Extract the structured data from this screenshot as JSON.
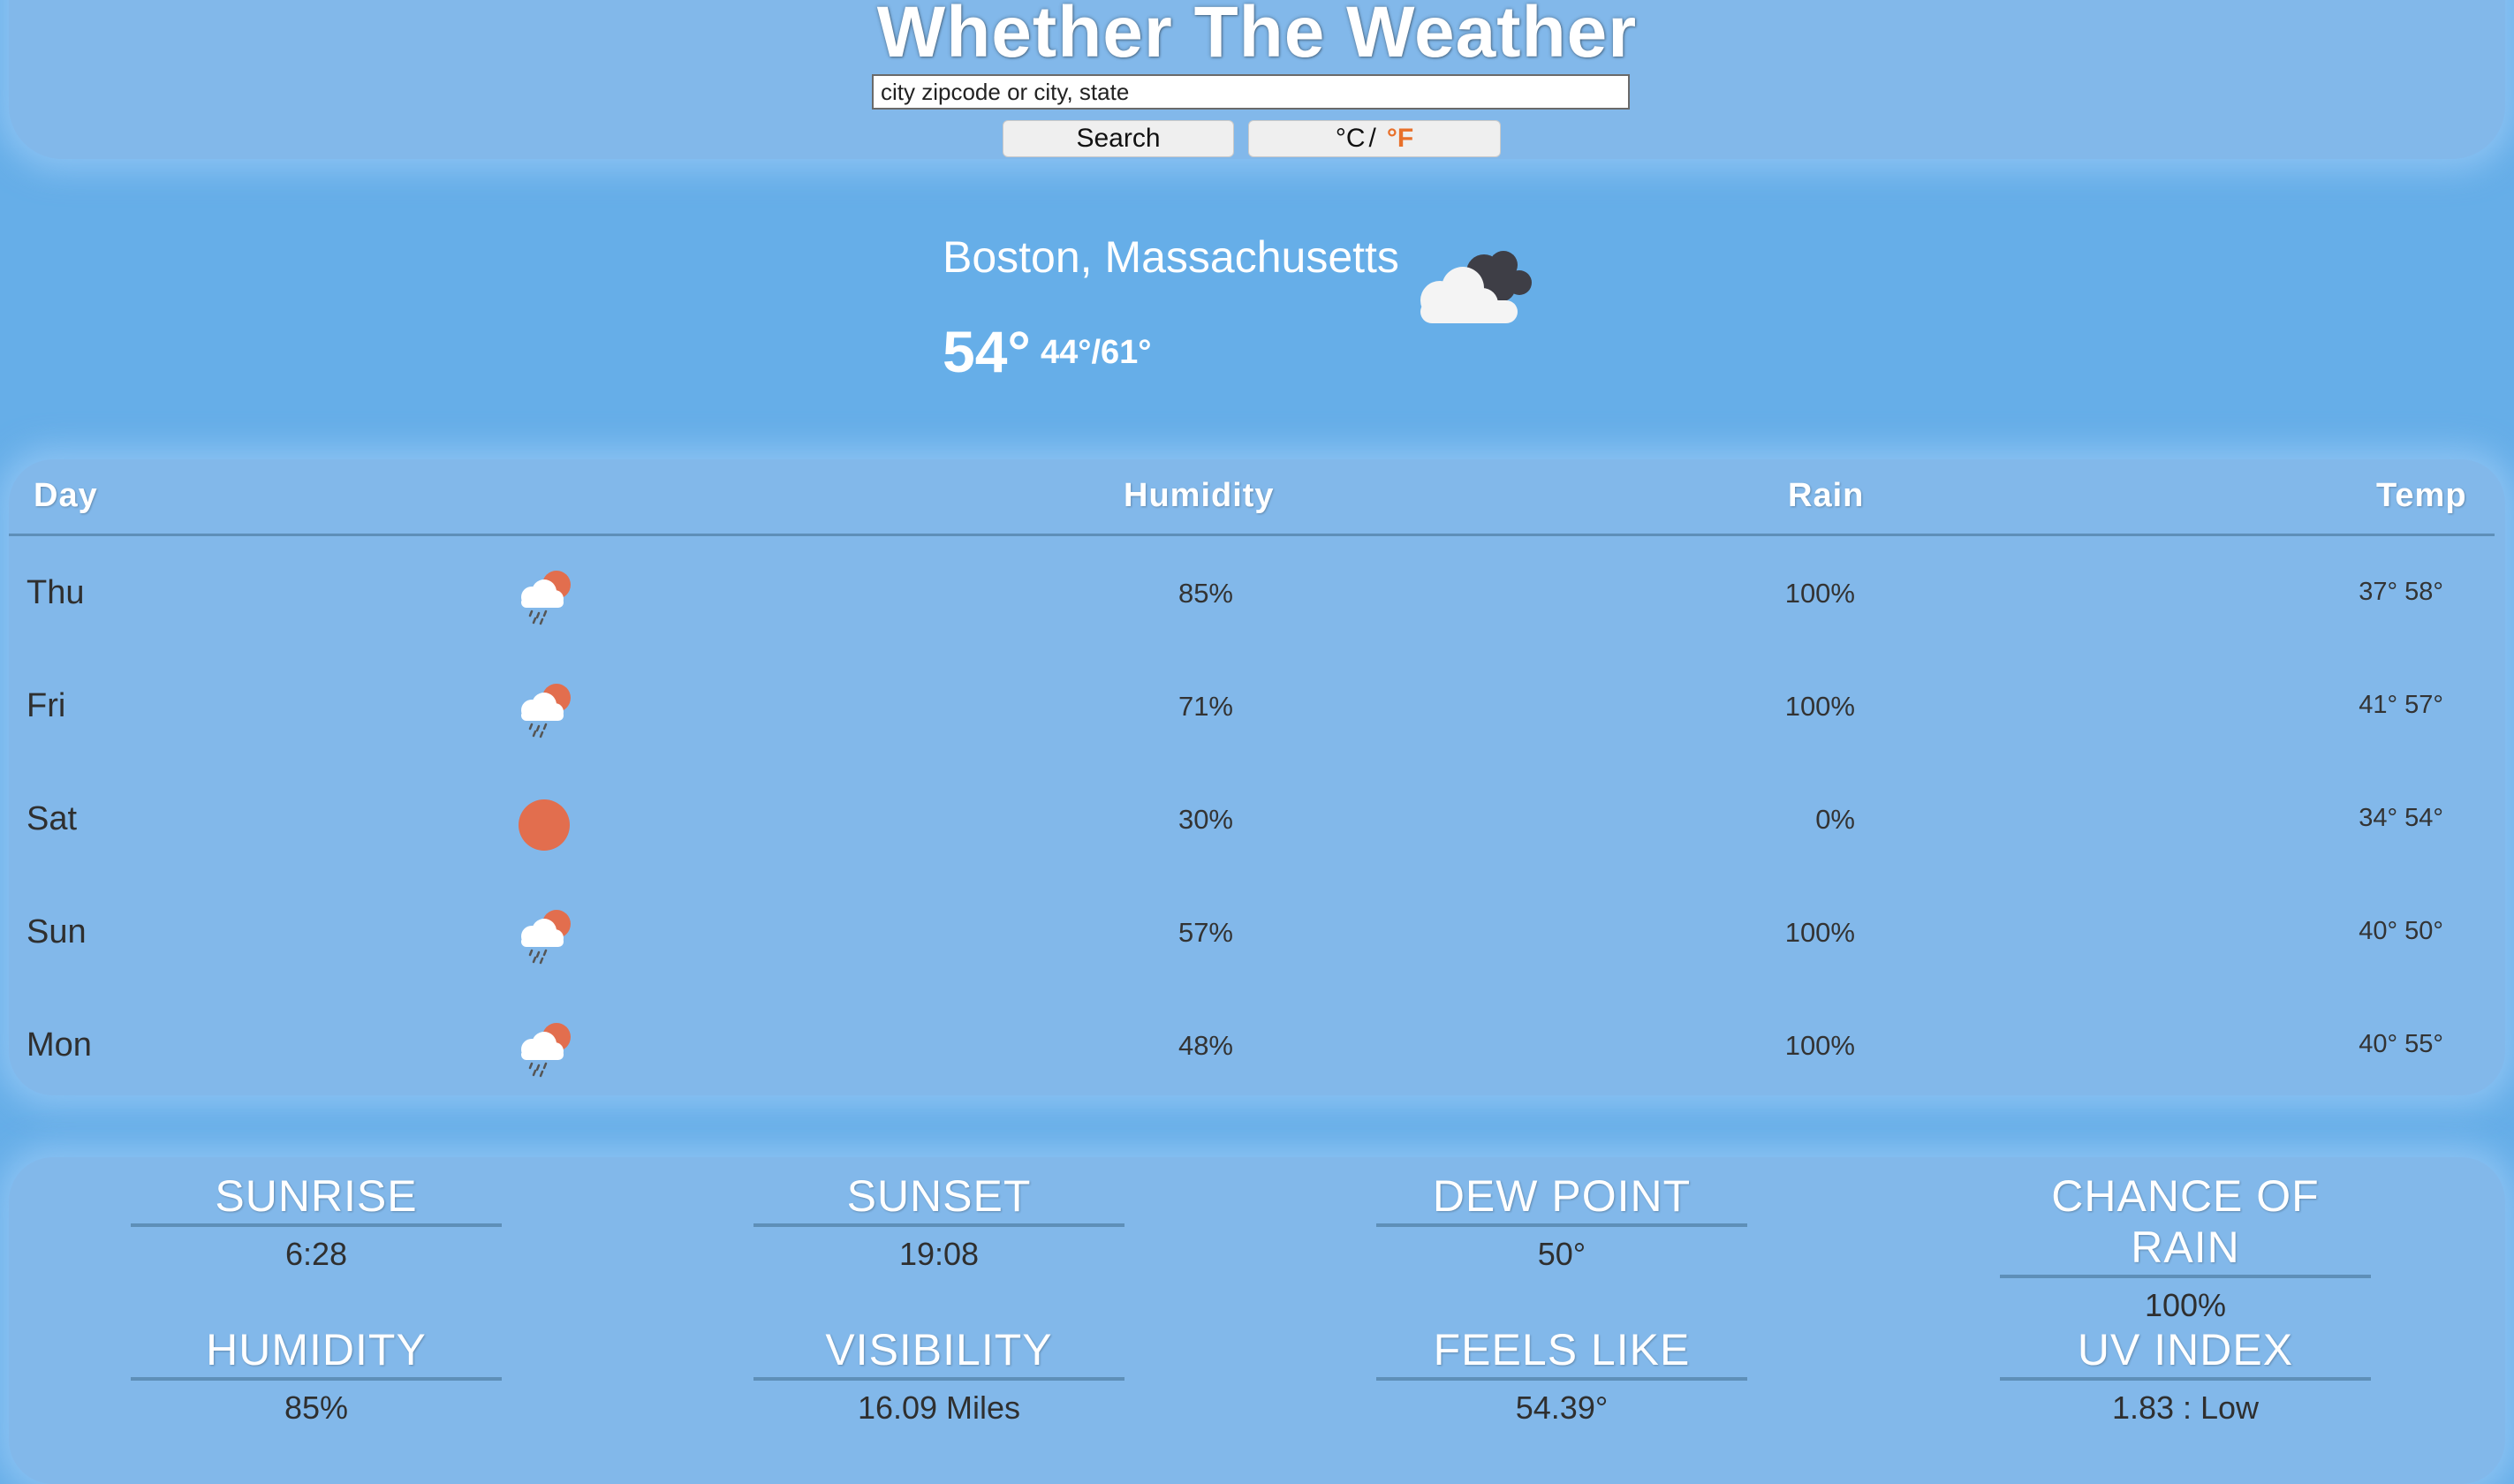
{
  "header": {
    "title": "Whether The Weather",
    "search_placeholder": "city zipcode or city, state",
    "search_label": "Search",
    "unit_c": "°C",
    "unit_sep": "/",
    "unit_f": "°F",
    "accent_color": "#e8702a"
  },
  "current": {
    "city": "Boston, Massachusetts",
    "temp": "54°",
    "range": "44°/61°",
    "icon": "cloud-icon"
  },
  "forecast": {
    "headers": {
      "day": "Day",
      "humidity": "Humidity",
      "rain": "Rain",
      "temp": "Temp"
    },
    "rows": [
      {
        "day": "Thu",
        "icon": "rain-partly-sunny-icon",
        "humidity": "85%",
        "rain": "100%",
        "temp": "37° 58°"
      },
      {
        "day": "Fri",
        "icon": "rain-partly-sunny-icon",
        "humidity": "71%",
        "rain": "100%",
        "temp": "41° 57°"
      },
      {
        "day": "Sat",
        "icon": "sun-icon",
        "humidity": "30%",
        "rain": "0%",
        "temp": "34° 54°"
      },
      {
        "day": "Sun",
        "icon": "rain-partly-sunny-icon",
        "humidity": "57%",
        "rain": "100%",
        "temp": "40° 50°"
      },
      {
        "day": "Mon",
        "icon": "rain-partly-sunny-icon",
        "humidity": "48%",
        "rain": "100%",
        "temp": "40° 55°"
      }
    ]
  },
  "details": {
    "sunrise": {
      "label": "SUNRISE",
      "value": "6:28"
    },
    "sunset": {
      "label": "SUNSET",
      "value": "19:08"
    },
    "dew_point": {
      "label": "DEW POINT",
      "value": "50°"
    },
    "chance_of_rain": {
      "label": "CHANCE OF RAIN",
      "value": "100%"
    },
    "humidity": {
      "label": "HUMIDITY",
      "value": "85%"
    },
    "visibility": {
      "label": "VISIBILITY",
      "value": "16.09 Miles"
    },
    "feels_like": {
      "label": "FEELS LIKE",
      "value": "54.39°"
    },
    "uv_index": {
      "label": "UV INDEX",
      "value": "1.83 : Low"
    }
  }
}
